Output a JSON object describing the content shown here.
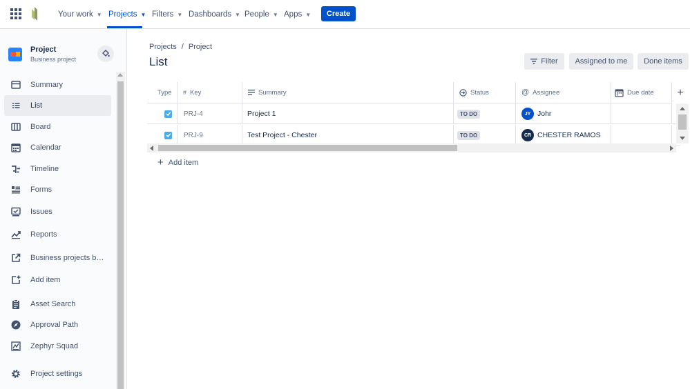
{
  "topnav": {
    "items": [
      {
        "label": "Your work",
        "active": false
      },
      {
        "label": "Projects",
        "active": true
      },
      {
        "label": "Filters",
        "active": false
      },
      {
        "label": "Dashboards",
        "active": false
      },
      {
        "label": "People",
        "active": false
      },
      {
        "label": "Apps",
        "active": false
      }
    ],
    "create_label": "Create",
    "accent": "#0052cc"
  },
  "project": {
    "name": "Project",
    "type": "Business project"
  },
  "sidebar": {
    "items": [
      {
        "label": "Summary",
        "icon": "summary-icon"
      },
      {
        "label": "List",
        "icon": "list-icon",
        "active": true
      },
      {
        "label": "Board",
        "icon": "board-icon"
      },
      {
        "label": "Calendar",
        "icon": "calendar-icon"
      },
      {
        "label": "Timeline",
        "icon": "timeline-icon"
      },
      {
        "label": "Forms",
        "icon": "forms-icon"
      },
      {
        "label": "Issues",
        "icon": "issues-icon"
      },
      {
        "label": "Reports",
        "icon": "reports-icon"
      },
      {
        "label": "Business projects bas...",
        "icon": "external-link-icon"
      },
      {
        "label": "Add item",
        "icon": "add-item-icon"
      },
      {
        "label": "Asset Search",
        "icon": "clipboard-icon"
      },
      {
        "label": "Approval Path",
        "icon": "compass-icon"
      },
      {
        "label": "Zephyr Squad",
        "icon": "zephyr-icon"
      },
      {
        "label": "Project settings",
        "icon": "gear-icon"
      }
    ]
  },
  "main": {
    "breadcrumb": [
      "Projects",
      "/",
      "Project"
    ],
    "title": "List",
    "buttons": {
      "filter": "Filter",
      "assigned": "Assigned to me",
      "done": "Done items"
    },
    "columns": {
      "type": "Type",
      "key": "Key",
      "summary": "Summary",
      "status": "Status",
      "assignee": "Assignee",
      "due": "Due date"
    },
    "rows": [
      {
        "key": "PRJ-4",
        "summary": "Project 1",
        "status": "TO DO",
        "assignee_initials": "JY",
        "assignee": "Johr",
        "avatar_color": "#0052cc"
      },
      {
        "key": "PRJ-9",
        "summary": "Test Project - Chester",
        "status": "TO DO",
        "assignee_initials": "CR",
        "assignee": "CHESTER RAMOS",
        "avatar_color": "#172b4d"
      }
    ],
    "add_item": "Add item"
  }
}
